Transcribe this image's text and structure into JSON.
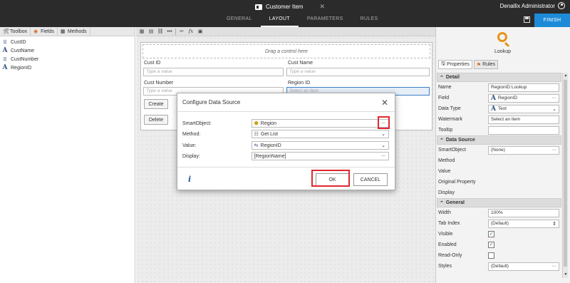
{
  "window": {
    "title": "Customer Item",
    "user": "Denallix Administrator",
    "tabs": [
      "GENERAL",
      "LAYOUT",
      "PARAMETERS",
      "RULES"
    ],
    "active_tab": "LAYOUT",
    "finish_label": "FINISH"
  },
  "left_panel": {
    "tabs": [
      "Toolbox",
      "Fields",
      "Methods"
    ],
    "items": [
      {
        "label": "CustID",
        "icon": "field-list-icon"
      },
      {
        "label": "CustName",
        "icon": "text-field-icon"
      },
      {
        "label": "CustNumber",
        "icon": "field-list-icon"
      },
      {
        "label": "RegionID",
        "icon": "text-field-icon"
      }
    ]
  },
  "canvas": {
    "drag_hint": "Drag a control here",
    "labels": {
      "cust_id": "Cust ID",
      "cust_name": "Cust Name",
      "cust_number": "Cust Number",
      "region_id": "Region ID"
    },
    "placeholders": {
      "cust_id": "Type a value",
      "cust_name": "Type a value",
      "cust_number": "Type a value",
      "region_id": "Select an item"
    },
    "buttons": {
      "create": "Create",
      "delete": "Delete"
    }
  },
  "modal": {
    "title": "Configure Data Source",
    "rows": {
      "smartobject_label": "SmartObject:",
      "smartobject_value": "Region",
      "method_label": "Method:",
      "method_value": "Get List",
      "value_label": "Value:",
      "value_value": "RegionID",
      "display_label": "Display:",
      "display_value": "[RegionName]"
    },
    "ok_label": "OK",
    "cancel_label": "CANCEL",
    "ellipsis": "..."
  },
  "right_panel": {
    "control_name": "Lookup",
    "tabs": [
      "Properties",
      "Rules"
    ],
    "detail_section": "Detail",
    "detail": {
      "name_label": "Name",
      "name_value": "RegionID Lookup",
      "field_label": "Field",
      "field_value": "RegionID",
      "datatype_label": "Data Type",
      "datatype_value": "Text",
      "watermark_label": "Watermark",
      "watermark_value": "Select an item",
      "tooltip_label": "Tooltip"
    },
    "datasource_section": "Data Source",
    "datasource": {
      "smartobject_label": "SmartObject",
      "smartobject_value": "(None)",
      "method_label": "Method",
      "value_label": "Value",
      "original_label": "Original Property",
      "display_label": "Display"
    },
    "general_section": "General",
    "general": {
      "width_label": "Width",
      "width_value": "100%",
      "tabindex_label": "Tab Index",
      "tabindex_value": "(Default)",
      "visible_label": "Visible",
      "visible_checked": true,
      "enabled_label": "Enabled",
      "enabled_checked": true,
      "readonly_label": "Read-Only",
      "readonly_checked": false,
      "styles_label": "Styles",
      "styles_value": "(Default)"
    }
  },
  "colors": {
    "accent": "#1e8bd8",
    "highlight": "#e0282e",
    "topbar": "#2b2b2b"
  }
}
